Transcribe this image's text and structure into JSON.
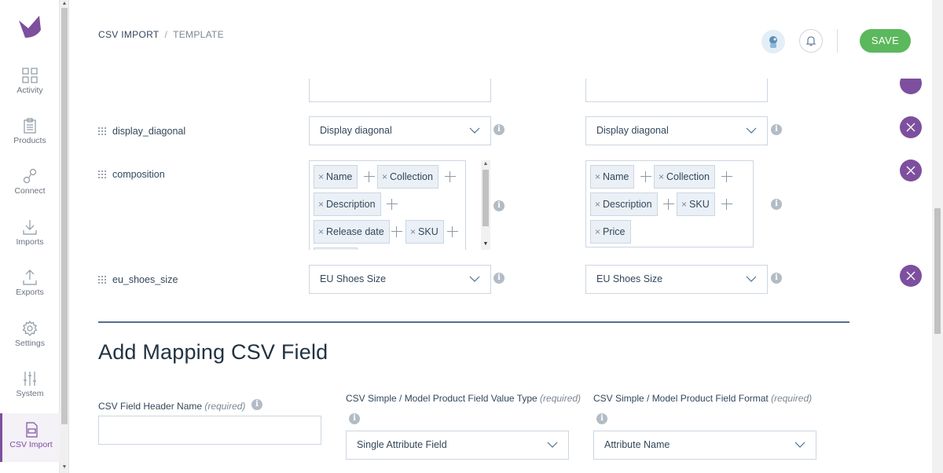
{
  "sidebar": {
    "items": [
      {
        "label": "Activity",
        "icon": "grid-icon"
      },
      {
        "label": "Products",
        "icon": "clipboard-icon"
      },
      {
        "label": "Connect",
        "icon": "link-icon"
      },
      {
        "label": "Imports",
        "icon": "download-icon"
      },
      {
        "label": "Exports",
        "icon": "upload-icon"
      },
      {
        "label": "Settings",
        "icon": "gear-icon"
      },
      {
        "label": "System",
        "icon": "sliders-icon"
      },
      {
        "label": "CSV Import",
        "icon": "csv-file-icon"
      }
    ],
    "active": "CSV Import"
  },
  "header": {
    "breadcrumb": [
      "CSV IMPORT",
      "TEMPLATE"
    ],
    "separator": "/",
    "save_label": "SAVE"
  },
  "mappings": [
    {
      "field": "display_diagonal",
      "left_select": "Display diagonal",
      "right_select": "Display diagonal"
    },
    {
      "field": "composition",
      "left_tags": [
        "Name",
        "Collection",
        "Description",
        "Release date",
        "SKU"
      ],
      "right_tags": [
        "Name",
        "Collection",
        "Description",
        "SKU",
        "Price"
      ]
    },
    {
      "field": "eu_shoes_size",
      "left_select": "EU Shoes Size",
      "right_select": "EU Shoes Size"
    }
  ],
  "add_section": {
    "title": "Add Mapping CSV Field",
    "header_name_label": "CSV Field Header Name",
    "header_name_value": "",
    "value_type_label": "CSV Simple / Model Product Field Value Type",
    "value_type_selected": "Single Attribute Field",
    "format_label": "CSV Simple / Model Product Field Format",
    "format_selected": "Attribute Name",
    "required_note": "(required)"
  },
  "colors": {
    "accent": "#7d4f9e",
    "save": "#5cb85c",
    "divider": "#516f90"
  }
}
